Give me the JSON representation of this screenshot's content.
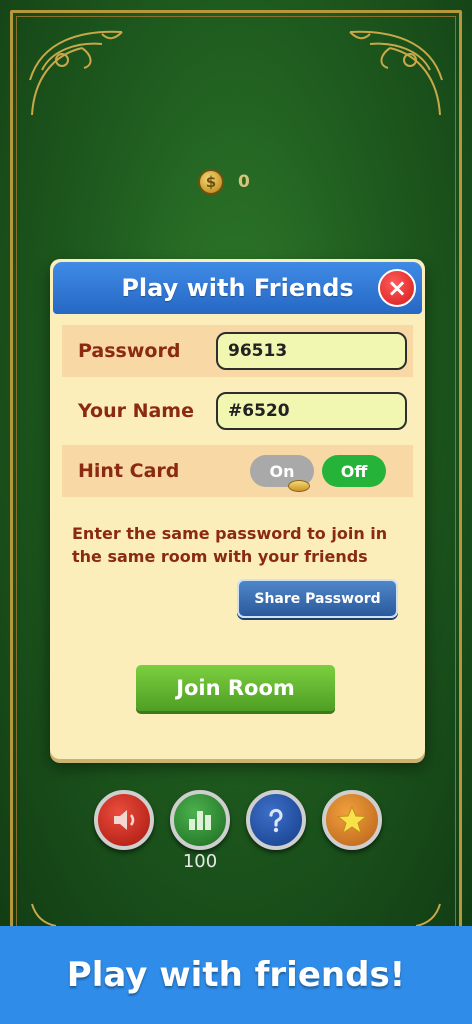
{
  "hud": {
    "coin_icon_label": "$",
    "coin_count": "0"
  },
  "dialog": {
    "title": "Play with Friends",
    "close_icon": "×",
    "password_label": "Password",
    "password_value": "96513",
    "name_label": "Your Name",
    "name_value": "#6520",
    "hint_label": "Hint Card",
    "hint_on_label": "On",
    "hint_off_label": "Off",
    "hint_selected": "Off",
    "note": "Enter the same password to join in the same room with your friends",
    "share_button": "Share Password",
    "join_button": "Join Room"
  },
  "bottom_bar": {
    "icons": [
      "sound-icon",
      "stats-icon",
      "help-icon",
      "star-icon"
    ],
    "stats_count": "100"
  },
  "banner": {
    "text": "Play with friends!"
  },
  "colors": {
    "felt": "#1f5c1f",
    "dialog_bg": "#fbeeba",
    "header_blue": "#2f7ad6",
    "label_brown": "#8a2a12",
    "toggle_on_grey": "#a9a9a9",
    "toggle_off_green": "#26b33a",
    "join_green": "#5fb52e",
    "banner_blue": "#2f8ce8"
  }
}
